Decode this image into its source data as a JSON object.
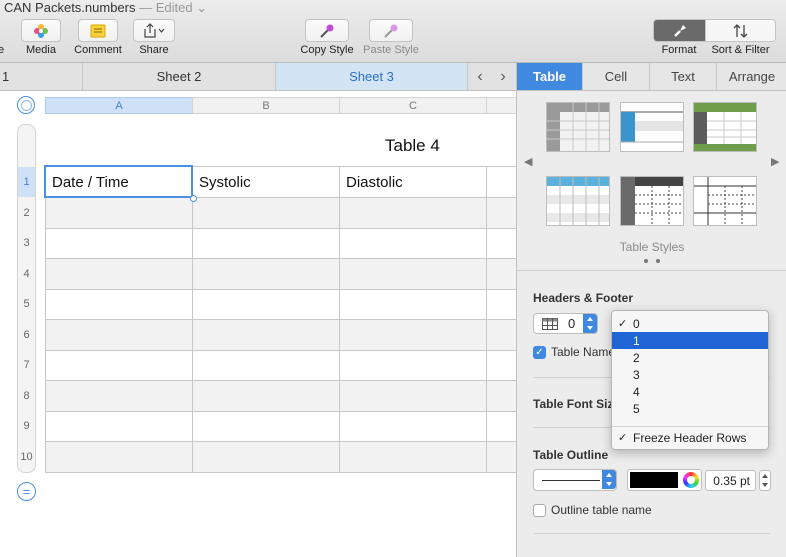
{
  "window": {
    "title": "CAN Packets.numbers",
    "status": "— Edited"
  },
  "toolbar": {
    "items": [
      {
        "label": "e",
        "icon": "truncated-icon"
      },
      {
        "label": "Media",
        "icon": "media-icon"
      },
      {
        "label": "Comment",
        "icon": "comment-icon"
      },
      {
        "label": "Share",
        "icon": "share-icon"
      },
      {
        "label": "Copy Style",
        "icon": "copy-style-icon"
      },
      {
        "label": "Paste Style",
        "icon": "paste-style-icon"
      },
      {
        "label": "Format",
        "icon": "format-brush-icon"
      },
      {
        "label": "Sort & Filter",
        "icon": "sort-filter-icon"
      }
    ]
  },
  "sheets": {
    "tabs": [
      "1",
      "Sheet 2",
      "Sheet 3"
    ],
    "active": "Sheet 3"
  },
  "table": {
    "title": "Table 4",
    "column_headers": [
      "A",
      "B",
      "C"
    ],
    "header_row": [
      "Date / Time",
      "Systolic",
      "Diastolic"
    ],
    "row_numbers": [
      "1",
      "2",
      "3",
      "4",
      "5",
      "6",
      "7",
      "8",
      "9",
      "10"
    ]
  },
  "inspector": {
    "tabs": [
      "Table",
      "Cell",
      "Text",
      "Arrange"
    ],
    "active_tab": "Table",
    "styles_label": "Table Styles",
    "headers_footer": {
      "title": "Headers & Footer",
      "header_rows_value": "0",
      "table_name_label": "Table Name",
      "table_name_checked": true
    },
    "font_size_title": "Table Font Size",
    "outline": {
      "title": "Table Outline",
      "color": "#000000",
      "width": "0.35 pt",
      "outline_name_label": "Outline table name",
      "outline_name_checked": false
    }
  },
  "popup_menu": {
    "items": [
      "0",
      "1",
      "2",
      "3",
      "4",
      "5"
    ],
    "checked": "0",
    "highlighted": "1",
    "freeze_label": "Freeze Header Rows",
    "freeze_checked": true,
    "check_glyph": "✓"
  },
  "colors": {
    "accent": "#3f8ae0",
    "menu_highlight": "#1f65d6",
    "selection": "#cfe1f6"
  }
}
